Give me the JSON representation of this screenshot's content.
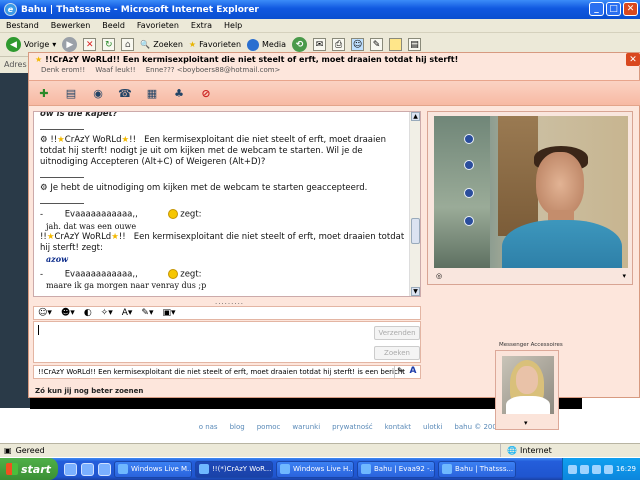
{
  "ie": {
    "title": "Bahu | Thatsssme - Microsoft Internet Explorer",
    "menu": [
      "Bestand",
      "Bewerken",
      "Beeld",
      "Favorieten",
      "Extra",
      "Help"
    ],
    "back_label": "Vorige",
    "search_label": "Zoeken",
    "favorites_label": "Favorieten",
    "media_label": "Media",
    "address_label": "Adres",
    "status_text": "Gereed",
    "zone_text": "Internet"
  },
  "page": {
    "links": [
      "o nas",
      "blog",
      "pomoc",
      "warunki",
      "prywatność",
      "kontakt",
      "ulotki",
      "bahu © 2008"
    ]
  },
  "msn": {
    "title": "!!CrAzY WoRLd!!   Een kermisexploitant die niet steelt of erft, moet draaien totdat hij sterft!",
    "sub1": "Denk erom!!",
    "sub2": "Waaf leuk!!",
    "sub3": "Enne??? <boyboers88@hotmail.com>",
    "convo": {
      "top_partial": "ow is die kapet?",
      "invite_text": "Een kermisexploitant die niet steelt of erft, moet draaien totdat hij sterft! nodigt je uit om kijken met de webcam te starten. Wil je de uitnodiging Accepteren (Alt+C) of Weigeren (Alt+D)?",
      "accepted_text": "Je hebt de uitnodiging om kijken met de webcam te starten geaccepteerd.",
      "sender1": "Evaaaaaaaaaaa,,",
      "says": "zegt:",
      "reply1": "jah. dat was een ouwe",
      "crazy_name": "CrAzY WoRLd",
      "crazy_msg": "Een kermisexploitant die niet steelt of erft, moet draaien totdat hij sterft! zegt:",
      "reply2": "azow",
      "sender2": "Evaaaaaaaaaaa,,",
      "reply3": "maare ik ga morgen naar venray dus ;p"
    },
    "send_label": "Verzenden",
    "search_label": "Zoeken",
    "nudge_text": "!!CrAzY WoRLd!!   Een kermisexploitant die niet steelt of erft, moet draaien totdat hij sterft! is een bericht",
    "typing_text": "Zó kun jij nog beter zoenen",
    "accessories_label": "Messenger Accessoires"
  },
  "taskbar": {
    "start_label": "start",
    "tasks": [
      "Windows Live M...",
      "!!(*)CrAzY WoR...",
      "Windows Live H...",
      "Bahu | Evaa92 -...",
      "Bahu | Thatsss..."
    ],
    "clock": "16:29"
  }
}
